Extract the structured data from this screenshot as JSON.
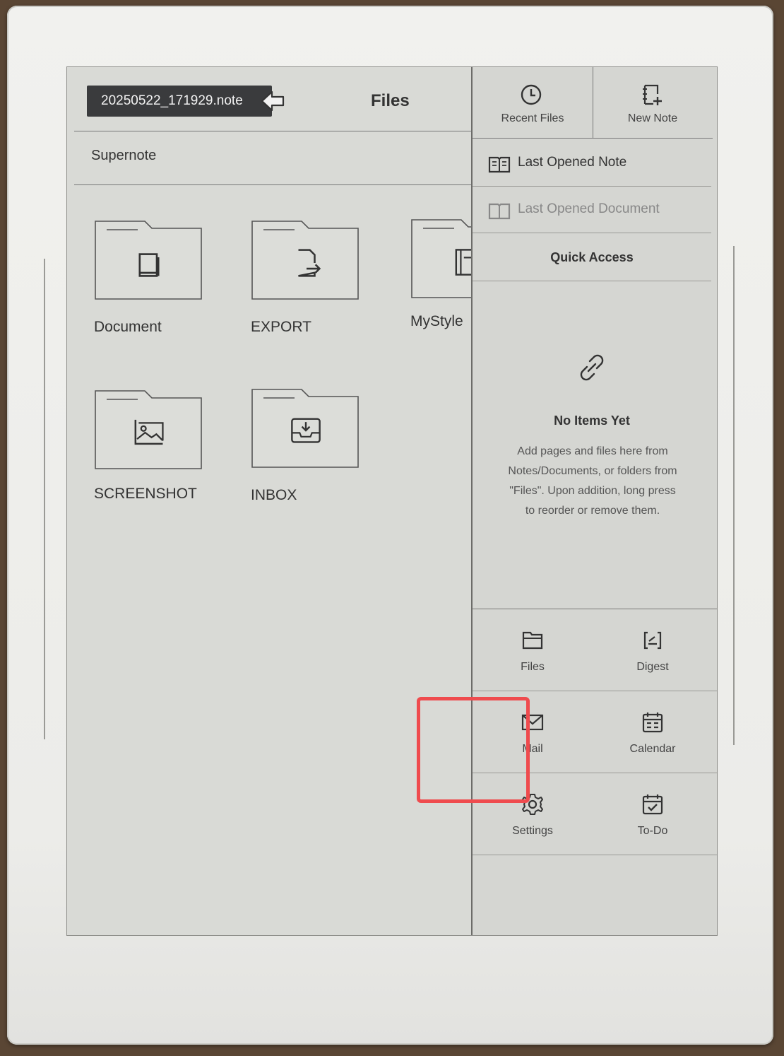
{
  "header": {
    "note_tab": "20250522_171929.note",
    "title": "Files"
  },
  "breadcrumb": "Supernote",
  "folders": [
    {
      "label": "Document",
      "icon": "book-icon"
    },
    {
      "label": "EXPORT",
      "icon": "export-icon"
    },
    {
      "label": "MyStyle",
      "icon": "template-icon"
    },
    {
      "label": "SCREENSHOT",
      "icon": "image-icon"
    },
    {
      "label": "INBOX",
      "icon": "inbox-icon"
    }
  ],
  "panel": {
    "recent_files": "Recent Files",
    "new_note": "New Note",
    "last_opened_note": "Last Opened Note",
    "last_opened_document": "Last Opened Document",
    "quick_access_title": "Quick Access",
    "empty_title": "No Items Yet",
    "empty_desc": "Add pages and files here from Notes/Documents, or folders from \"Files\". Upon addition, long press to reorder or remove them.",
    "apps": [
      {
        "label": "Files",
        "icon": "folder-icon"
      },
      {
        "label": "Digest",
        "icon": "digest-icon"
      },
      {
        "label": "Mail",
        "icon": "mail-icon"
      },
      {
        "label": "Calendar",
        "icon": "calendar-icon"
      },
      {
        "label": "Settings",
        "icon": "gear-icon"
      },
      {
        "label": "To-Do",
        "icon": "todo-icon"
      }
    ]
  },
  "colors": {
    "highlight": "#ef4b4e",
    "tab_bg": "#3a3b3d",
    "screen_bg": "#d9dad6"
  }
}
